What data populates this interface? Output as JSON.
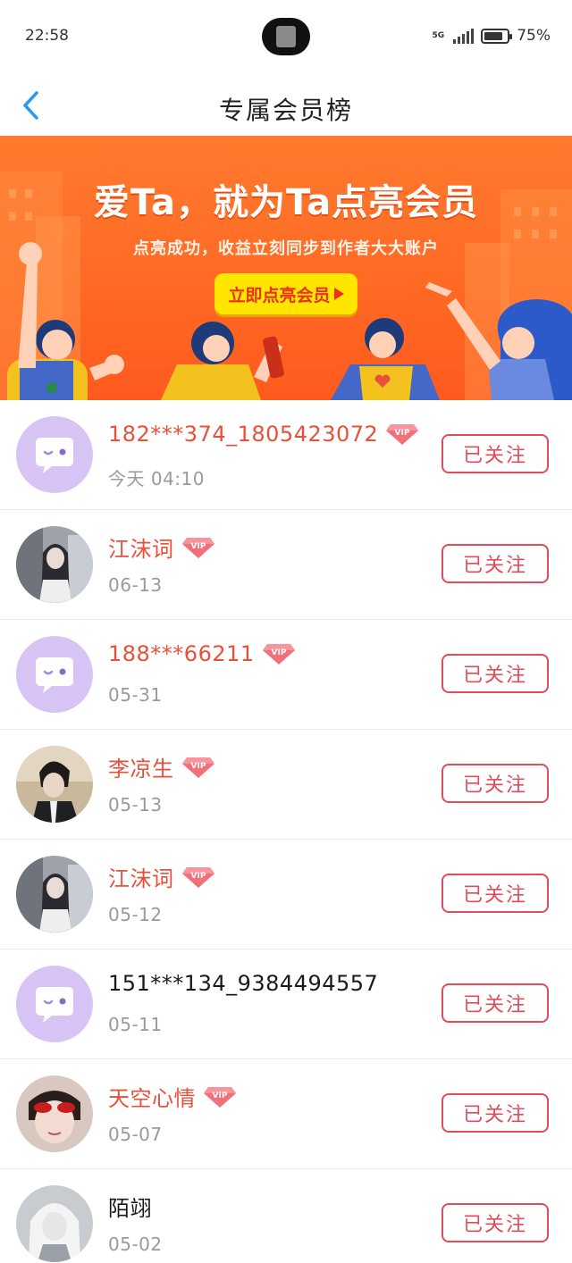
{
  "status": {
    "time": "22:58",
    "network": "5G",
    "battery": "75%"
  },
  "nav": {
    "title": "专属会员榜"
  },
  "banner": {
    "title": "爱Ta，就为Ta点亮会员",
    "subtitle": "点亮成功，收益立刻同步到作者大大账户",
    "button_label": "立即点亮会员"
  },
  "vip_badge": "VIP",
  "follow_label": "已关注",
  "rows": [
    {
      "name": "182***374_1805423072",
      "date": "今天 04:10",
      "vip": true
    },
    {
      "name": "江沫词",
      "date": "06-13",
      "vip": true
    },
    {
      "name": "188***66211",
      "date": "05-31",
      "vip": true
    },
    {
      "name": "李凉生",
      "date": "05-13",
      "vip": true
    },
    {
      "name": "江沫词",
      "date": "05-12",
      "vip": true
    },
    {
      "name": "151***134_9384494557",
      "date": "05-11",
      "vip": false
    },
    {
      "name": "天空心情",
      "date": "05-07",
      "vip": true
    },
    {
      "name": "陌翊",
      "date": "05-02",
      "vip": false
    }
  ],
  "colors": {
    "accent_red": "#e04c5c",
    "vip_name": "#e8503a",
    "banner_orange": "#ff6a24",
    "button_yellow": "#ffe500",
    "back_blue": "#2a9af0"
  }
}
